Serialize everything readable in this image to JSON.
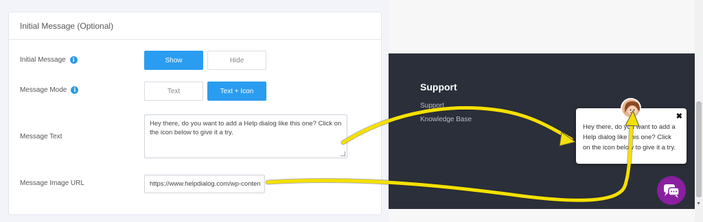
{
  "settings": {
    "panel_title": "Initial Message (Optional)",
    "initial_message": {
      "label": "Initial Message",
      "options": [
        "Show",
        "Hide"
      ],
      "selected": "Show"
    },
    "message_mode": {
      "label": "Message Mode",
      "options": [
        "Text",
        "Text + Icon"
      ],
      "selected": "Text + Icon"
    },
    "message_text": {
      "label": "Message Text",
      "value": "Hey there, do you want to add a Help dialog like this one? Click on the icon below to give it a try."
    },
    "message_image_url": {
      "label": "Message Image URL",
      "value": "https://www.helpdialog.com/wp-conten"
    }
  },
  "preview": {
    "footer_heading": "Support",
    "links": [
      "Support",
      "Knowledge Base"
    ],
    "bubble_text": "Hey there, do you want to add a Help dialog like this one? Click on the icon below to give it a try.",
    "close_glyph": "✖"
  },
  "colors": {
    "accent": "#2a9df0",
    "dark_footer": "#2a2f3a",
    "chat_button": "#8a1fa0",
    "arrow": "#f5e000"
  },
  "icons": [
    "info-icon",
    "resize-handle-icon",
    "close-icon",
    "avatar-image",
    "chat-icon",
    "arrow-annotation"
  ]
}
